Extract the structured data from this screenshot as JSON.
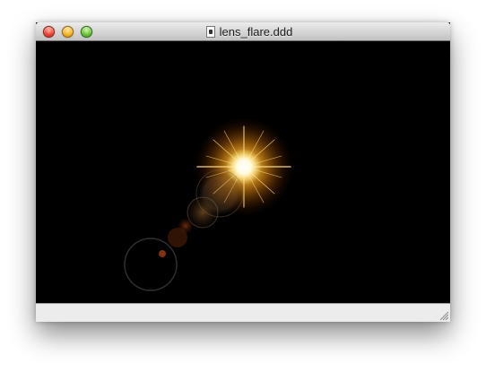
{
  "window": {
    "title": "lens_flare.ddd",
    "controls": {
      "close": "close-button",
      "minimize": "minimize-button",
      "zoom": "zoom-button"
    }
  },
  "document_icon": "document-icon",
  "canvas": {
    "background": "#000000",
    "flare_core_color": "#ffffff",
    "flare_glow_color": "#ffb21a",
    "halo_color": "#ff9a10"
  },
  "statusbar": {
    "resize_icon": "resize-grip-icon"
  }
}
